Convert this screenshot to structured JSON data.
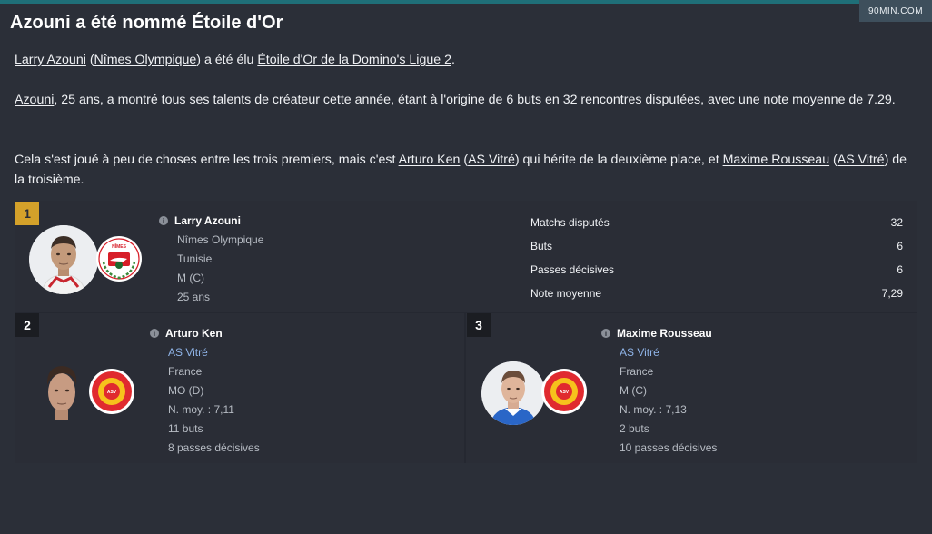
{
  "header": {
    "title": "Azouni a été nommé Étoile d'Or",
    "watermark": "90MIN.COM"
  },
  "article": {
    "p1": {
      "player_link": "Larry Azouni",
      "open_paren": " (",
      "club_link": "Nîmes Olympique",
      "mid": ") a été élu ",
      "award_link": "Étoile d'Or de la Domino's Ligue 2",
      "end": "."
    },
    "p2": {
      "player_link": "Azouni",
      "text": ", 25 ans, a montré tous ses talents de créateur cette année, étant à l'origine de 6 buts en 32 rencontres disputées, avec une note moyenne de 7.29."
    },
    "p3": {
      "start": "Cela s'est joué à peu de choses entre les trois premiers, mais c'est ",
      "second_link": "Arturo Ken",
      "sp1": " (",
      "second_club_link": "AS Vitré",
      "mid": ") qui hérite de la deuxième place, et ",
      "third_link": "Maxime Rousseau",
      "sp2": " (",
      "third_club_link": "AS Vitré",
      "end": ") de la troisième."
    }
  },
  "winner": {
    "rank": "1",
    "name": "Larry Azouni",
    "club": "Nîmes Olympique",
    "nationality": "Tunisie",
    "position": "M (C)",
    "age": "25 ans",
    "stats": [
      {
        "label": "Matchs disputés",
        "value": "32"
      },
      {
        "label": "Buts",
        "value": "6"
      },
      {
        "label": "Passes décisives",
        "value": "6"
      },
      {
        "label": "Note moyenne",
        "value": "7,29"
      }
    ]
  },
  "second": {
    "rank": "2",
    "name": "Arturo Ken",
    "club": "AS Vitré",
    "nationality": "France",
    "position": "MO (D)",
    "rating": "N. moy. : 7,11",
    "goals": "11 buts",
    "assists": "8 passes décisives"
  },
  "third": {
    "rank": "3",
    "name": "Maxime Rousseau",
    "club": "AS Vitré",
    "nationality": "France",
    "position": "M (C)",
    "rating": "N. moy. : 7,13",
    "goals": "2 buts",
    "assists": "10 passes décisives"
  },
  "colors": {
    "background": "#2b2f38",
    "card": "#2a2d36",
    "gold": "#d4a12a",
    "club_link": "#8fb4e8"
  },
  "icons": [
    "info-icon",
    "player-avatar",
    "club-badge"
  ]
}
